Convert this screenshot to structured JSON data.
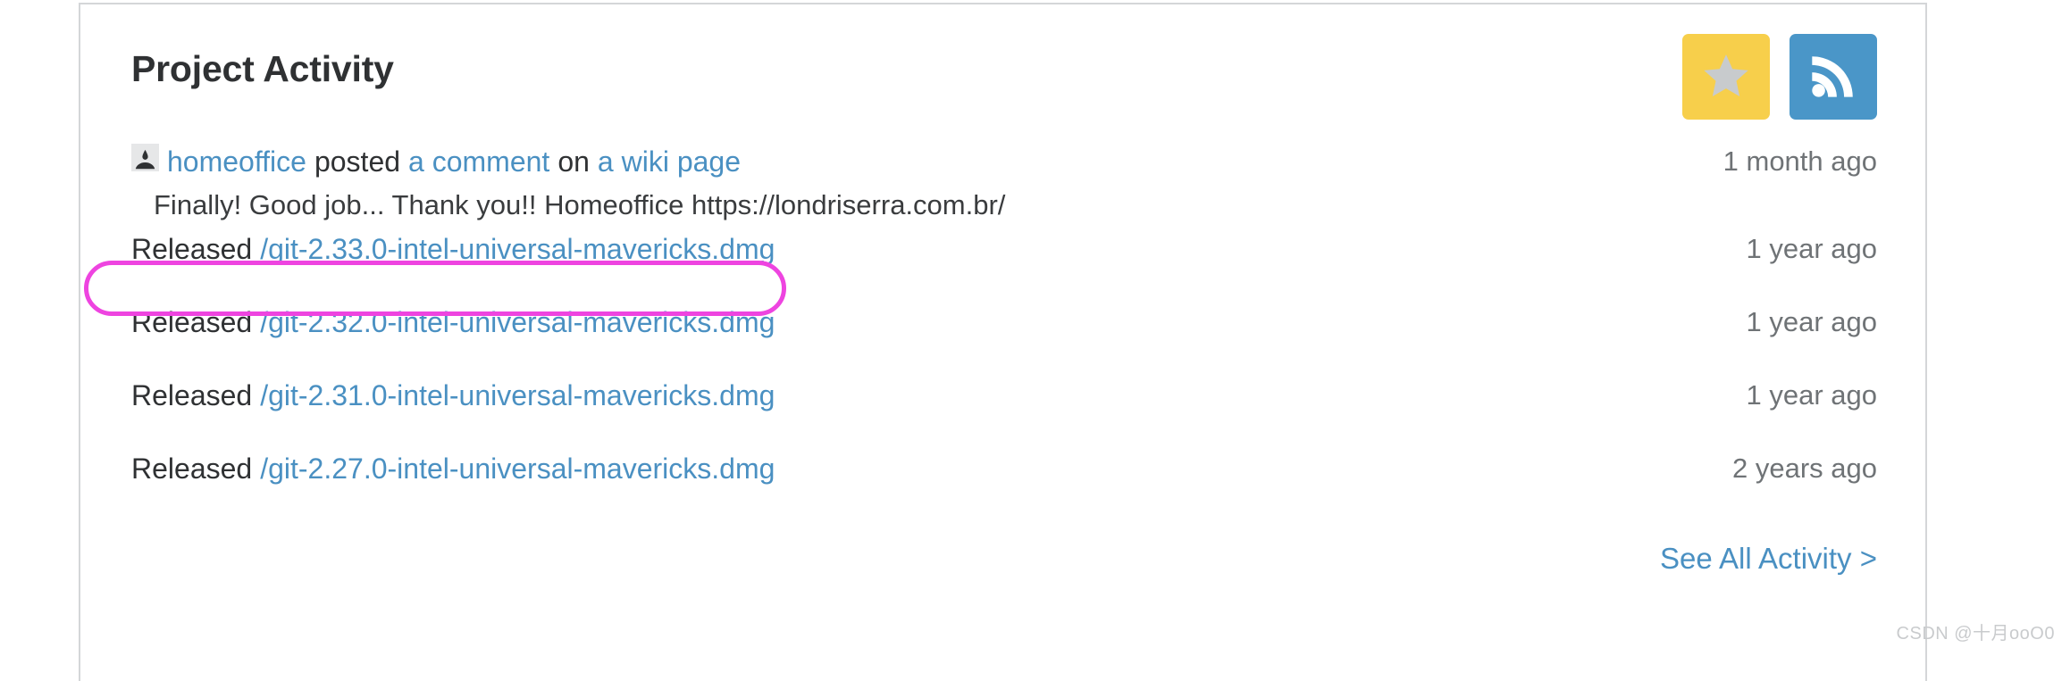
{
  "card": {
    "title": "Project Activity",
    "actions": [
      {
        "name": "star-button",
        "icon": "star-icon",
        "bg": "#f7cf4b",
        "icon_color": "#c8cbcd"
      },
      {
        "name": "rss-button",
        "icon": "rss-icon",
        "bg": "#4a96c8",
        "icon_color": "#ffffff"
      }
    ],
    "see_all_label": "See All Activity >"
  },
  "colors": {
    "link": "#4a90c2",
    "text": "#2f3133",
    "muted": "#6f7376",
    "card_border": "#d4d6d8",
    "highlight": "#ee44e0",
    "star_bg": "#f7cf4b",
    "rss_bg": "#4a96c8"
  },
  "activity": [
    {
      "type": "comment",
      "avatar_icon": "user-avatar-icon",
      "author": "homeoffice",
      "verb": "posted",
      "object": "a comment",
      "preposition": "on",
      "target": "a wiki page",
      "body": "Finally! Good job... Thank you!! Homeoffice https://londriserra.com.br/",
      "timestamp": "1 month ago",
      "highlighted": false
    },
    {
      "type": "release",
      "verb": "Released",
      "file": "/git-2.33.0-intel-universal-mavericks.dmg",
      "timestamp": "1 year ago",
      "highlighted": true
    },
    {
      "type": "release",
      "verb": "Released",
      "file": "/git-2.32.0-intel-universal-mavericks.dmg",
      "timestamp": "1 year ago",
      "highlighted": false
    },
    {
      "type": "release",
      "verb": "Released",
      "file": "/git-2.31.0-intel-universal-mavericks.dmg",
      "timestamp": "1 year ago",
      "highlighted": false
    },
    {
      "type": "release",
      "verb": "Released",
      "file": "/git-2.27.0-intel-universal-mavericks.dmg",
      "timestamp": "2 years ago",
      "highlighted": false
    }
  ],
  "watermark": "CSDN @十月ooO0"
}
